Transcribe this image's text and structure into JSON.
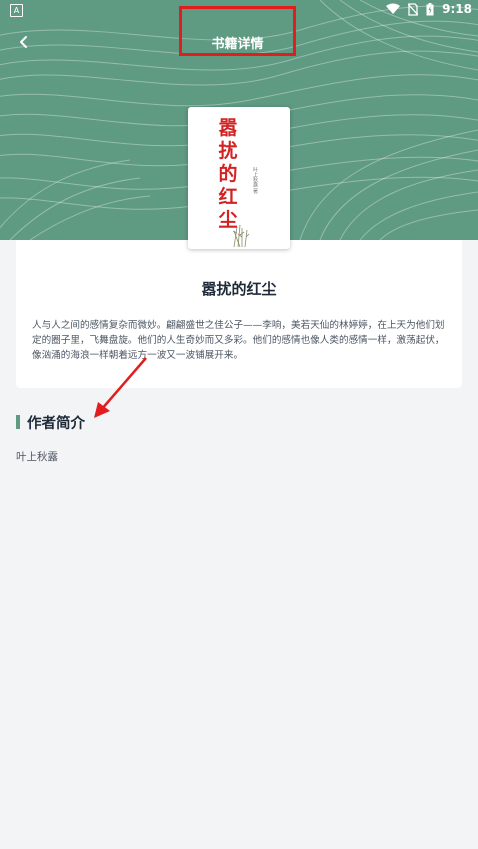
{
  "status_bar": {
    "app_icon_letter": "A",
    "time": "9:18"
  },
  "nav": {
    "title": "书籍详情"
  },
  "book": {
    "cover_title_chars": [
      "嚣",
      "扰",
      "的",
      "红",
      "尘"
    ],
    "cover_author": "叶上秋露 著",
    "name": "嚣扰的红尘",
    "description": "人与人之间的感情复杂而微妙。翩翩盛世之佳公子——李响，美若天仙的林婷婷，在上天为他们划定的圈子里，飞舞盘旋。他们的人生奇妙而又多彩。他们的感情也像人类的感情一样，激荡起伏，像汹涌的海浪一样朝着远方一波又一波铺展开来。"
  },
  "author_section": {
    "heading": "作者简介",
    "author_name": "叶上秋露"
  },
  "colors": {
    "header_green": "#5f9a82",
    "annotation_red": "#e11d1d",
    "cover_title_red": "#d32222"
  }
}
